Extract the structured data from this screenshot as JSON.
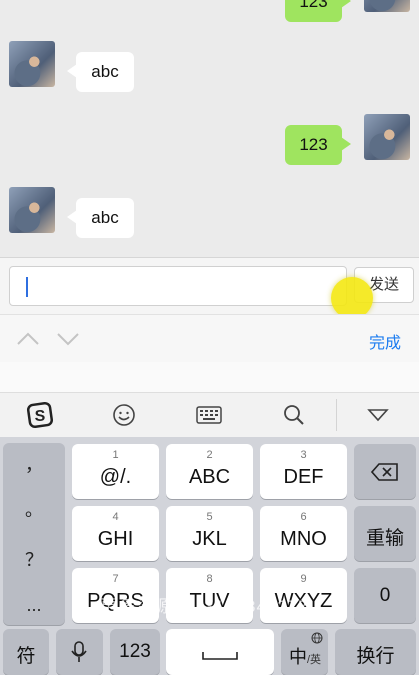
{
  "messages": [
    {
      "side": "right",
      "text": "123",
      "partial": true
    },
    {
      "side": "left",
      "text": "abc"
    },
    {
      "side": "right",
      "text": "123"
    },
    {
      "side": "left",
      "text": "abc"
    }
  ],
  "composer": {
    "value": "",
    "send_label": "发送"
  },
  "accessory": {
    "done_label": "完成"
  },
  "toolbar": {
    "icons": [
      "sogou-logo-icon",
      "emoji-icon",
      "keyboard-icon",
      "search-icon",
      "collapse-keyboard-icon"
    ]
  },
  "keyboard": {
    "punctuation": [
      "，",
      "。",
      "？",
      "..."
    ],
    "keys": [
      {
        "num": "1",
        "label": "@/."
      },
      {
        "num": "2",
        "label": "ABC"
      },
      {
        "num": "3",
        "label": "DEF"
      },
      {
        "num": "4",
        "label": "GHI"
      },
      {
        "num": "5",
        "label": "JKL"
      },
      {
        "num": "6",
        "label": "MNO"
      },
      {
        "num": "7",
        "label": "PQRS"
      },
      {
        "num": "8",
        "label": "TUV"
      },
      {
        "num": "9",
        "label": "WXYZ"
      }
    ],
    "retype_label": "重输",
    "zero_label": "0",
    "symbol_label": "符",
    "numbers_label": "123",
    "lang_label": "中",
    "lang_sub": "/英",
    "return_label": "换行"
  },
  "watermark": "更多资源Q：3190342277",
  "colors": {
    "sent_bubble": "#9fe45f",
    "accent": "#1c7cf0",
    "touch_indicator": "#f4e812"
  }
}
